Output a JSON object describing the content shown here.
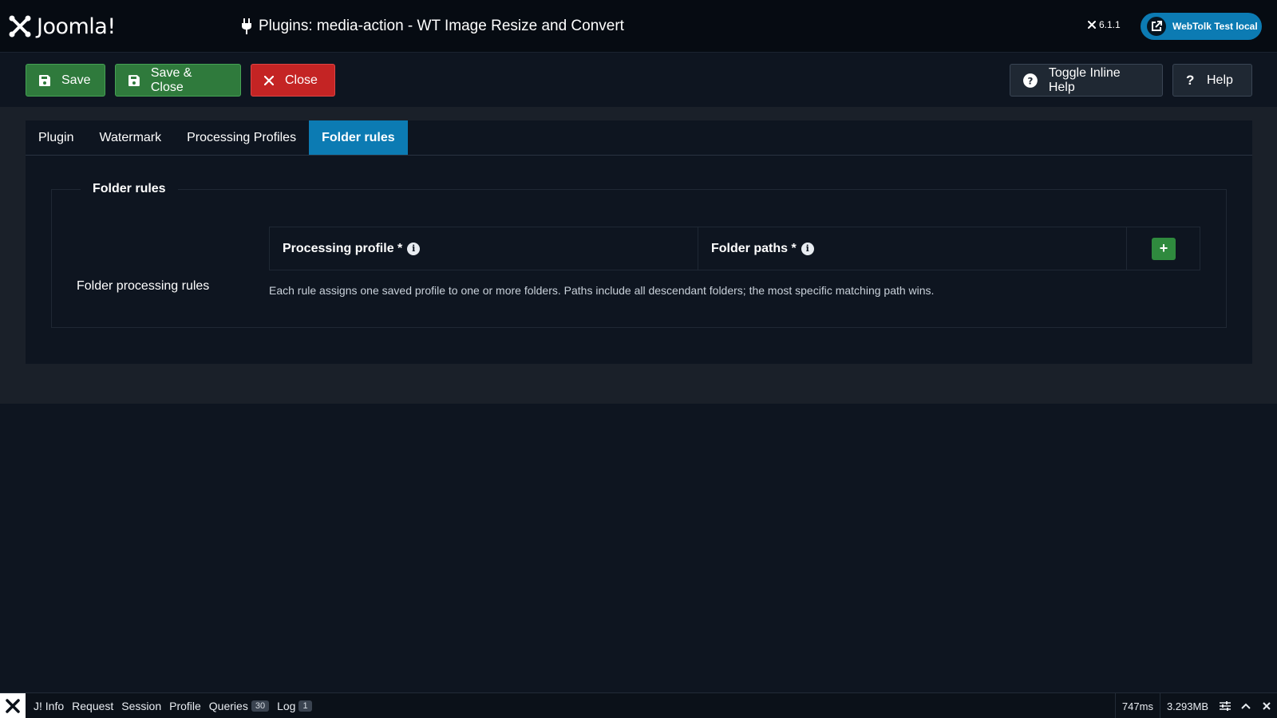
{
  "header": {
    "logo_text": "Joomla!",
    "title": "Plugins: media-action - WT Image Resize and Convert",
    "version": "6.1.1",
    "site_button_label": "WebTolk Test local"
  },
  "toolbar": {
    "save_label": "Save",
    "save_close_label": "Save & Close",
    "close_label": "Close",
    "inline_help_label": "Toggle Inline Help",
    "help_label": "Help"
  },
  "tabs": [
    {
      "label": "Plugin",
      "active": false
    },
    {
      "label": "Watermark",
      "active": false
    },
    {
      "label": "Processing Profiles",
      "active": false
    },
    {
      "label": "Folder rules",
      "active": true
    }
  ],
  "folder_rules": {
    "legend": "Folder rules",
    "field_label": "Folder processing rules",
    "col_profile": "Processing profile *",
    "col_paths": "Folder paths *",
    "add_label": "+",
    "hint": "Each rule assigns one saved profile to one or more folders. Paths include all descendant folders; the most specific matching path wins."
  },
  "debugbar": {
    "items": [
      {
        "label": "J! Info"
      },
      {
        "label": "Request"
      },
      {
        "label": "Session"
      },
      {
        "label": "Profile"
      },
      {
        "label": "Queries",
        "badge": "30"
      },
      {
        "label": "Log",
        "badge": "1"
      }
    ],
    "time": "747ms",
    "memory": "3.293MB"
  },
  "colors": {
    "accent": "#0c7bb3",
    "success": "#2f7a3c",
    "danger": "#c42424",
    "background": "#0e1520"
  }
}
